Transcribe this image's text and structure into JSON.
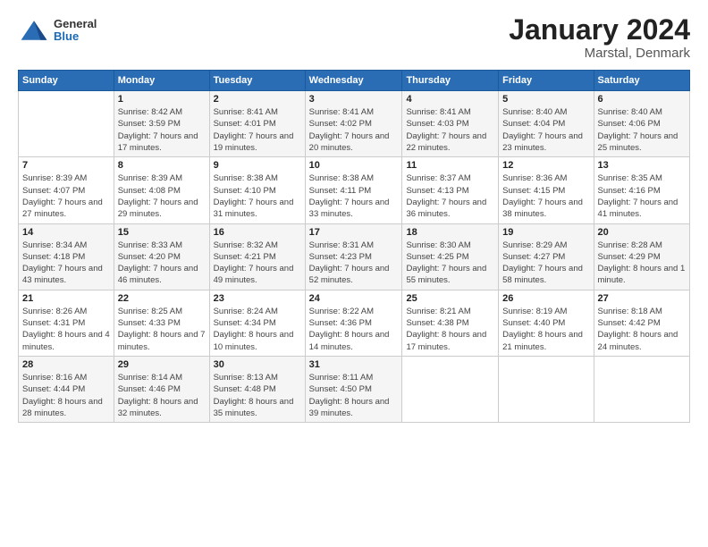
{
  "header": {
    "logo": {
      "general": "General",
      "blue": "Blue"
    },
    "title": "January 2024",
    "location": "Marstal, Denmark"
  },
  "weekdays": [
    "Sunday",
    "Monday",
    "Tuesday",
    "Wednesday",
    "Thursday",
    "Friday",
    "Saturday"
  ],
  "weeks": [
    [
      {
        "day": "",
        "sunrise": "",
        "sunset": "",
        "daylight": ""
      },
      {
        "day": "1",
        "sunrise": "Sunrise: 8:42 AM",
        "sunset": "Sunset: 3:59 PM",
        "daylight": "Daylight: 7 hours and 17 minutes."
      },
      {
        "day": "2",
        "sunrise": "Sunrise: 8:41 AM",
        "sunset": "Sunset: 4:01 PM",
        "daylight": "Daylight: 7 hours and 19 minutes."
      },
      {
        "day": "3",
        "sunrise": "Sunrise: 8:41 AM",
        "sunset": "Sunset: 4:02 PM",
        "daylight": "Daylight: 7 hours and 20 minutes."
      },
      {
        "day": "4",
        "sunrise": "Sunrise: 8:41 AM",
        "sunset": "Sunset: 4:03 PM",
        "daylight": "Daylight: 7 hours and 22 minutes."
      },
      {
        "day": "5",
        "sunrise": "Sunrise: 8:40 AM",
        "sunset": "Sunset: 4:04 PM",
        "daylight": "Daylight: 7 hours and 23 minutes."
      },
      {
        "day": "6",
        "sunrise": "Sunrise: 8:40 AM",
        "sunset": "Sunset: 4:06 PM",
        "daylight": "Daylight: 7 hours and 25 minutes."
      }
    ],
    [
      {
        "day": "7",
        "sunrise": "Sunrise: 8:39 AM",
        "sunset": "Sunset: 4:07 PM",
        "daylight": "Daylight: 7 hours and 27 minutes."
      },
      {
        "day": "8",
        "sunrise": "Sunrise: 8:39 AM",
        "sunset": "Sunset: 4:08 PM",
        "daylight": "Daylight: 7 hours and 29 minutes."
      },
      {
        "day": "9",
        "sunrise": "Sunrise: 8:38 AM",
        "sunset": "Sunset: 4:10 PM",
        "daylight": "Daylight: 7 hours and 31 minutes."
      },
      {
        "day": "10",
        "sunrise": "Sunrise: 8:38 AM",
        "sunset": "Sunset: 4:11 PM",
        "daylight": "Daylight: 7 hours and 33 minutes."
      },
      {
        "day": "11",
        "sunrise": "Sunrise: 8:37 AM",
        "sunset": "Sunset: 4:13 PM",
        "daylight": "Daylight: 7 hours and 36 minutes."
      },
      {
        "day": "12",
        "sunrise": "Sunrise: 8:36 AM",
        "sunset": "Sunset: 4:15 PM",
        "daylight": "Daylight: 7 hours and 38 minutes."
      },
      {
        "day": "13",
        "sunrise": "Sunrise: 8:35 AM",
        "sunset": "Sunset: 4:16 PM",
        "daylight": "Daylight: 7 hours and 41 minutes."
      }
    ],
    [
      {
        "day": "14",
        "sunrise": "Sunrise: 8:34 AM",
        "sunset": "Sunset: 4:18 PM",
        "daylight": "Daylight: 7 hours and 43 minutes."
      },
      {
        "day": "15",
        "sunrise": "Sunrise: 8:33 AM",
        "sunset": "Sunset: 4:20 PM",
        "daylight": "Daylight: 7 hours and 46 minutes."
      },
      {
        "day": "16",
        "sunrise": "Sunrise: 8:32 AM",
        "sunset": "Sunset: 4:21 PM",
        "daylight": "Daylight: 7 hours and 49 minutes."
      },
      {
        "day": "17",
        "sunrise": "Sunrise: 8:31 AM",
        "sunset": "Sunset: 4:23 PM",
        "daylight": "Daylight: 7 hours and 52 minutes."
      },
      {
        "day": "18",
        "sunrise": "Sunrise: 8:30 AM",
        "sunset": "Sunset: 4:25 PM",
        "daylight": "Daylight: 7 hours and 55 minutes."
      },
      {
        "day": "19",
        "sunrise": "Sunrise: 8:29 AM",
        "sunset": "Sunset: 4:27 PM",
        "daylight": "Daylight: 7 hours and 58 minutes."
      },
      {
        "day": "20",
        "sunrise": "Sunrise: 8:28 AM",
        "sunset": "Sunset: 4:29 PM",
        "daylight": "Daylight: 8 hours and 1 minute."
      }
    ],
    [
      {
        "day": "21",
        "sunrise": "Sunrise: 8:26 AM",
        "sunset": "Sunset: 4:31 PM",
        "daylight": "Daylight: 8 hours and 4 minutes."
      },
      {
        "day": "22",
        "sunrise": "Sunrise: 8:25 AM",
        "sunset": "Sunset: 4:33 PM",
        "daylight": "Daylight: 8 hours and 7 minutes."
      },
      {
        "day": "23",
        "sunrise": "Sunrise: 8:24 AM",
        "sunset": "Sunset: 4:34 PM",
        "daylight": "Daylight: 8 hours and 10 minutes."
      },
      {
        "day": "24",
        "sunrise": "Sunrise: 8:22 AM",
        "sunset": "Sunset: 4:36 PM",
        "daylight": "Daylight: 8 hours and 14 minutes."
      },
      {
        "day": "25",
        "sunrise": "Sunrise: 8:21 AM",
        "sunset": "Sunset: 4:38 PM",
        "daylight": "Daylight: 8 hours and 17 minutes."
      },
      {
        "day": "26",
        "sunrise": "Sunrise: 8:19 AM",
        "sunset": "Sunset: 4:40 PM",
        "daylight": "Daylight: 8 hours and 21 minutes."
      },
      {
        "day": "27",
        "sunrise": "Sunrise: 8:18 AM",
        "sunset": "Sunset: 4:42 PM",
        "daylight": "Daylight: 8 hours and 24 minutes."
      }
    ],
    [
      {
        "day": "28",
        "sunrise": "Sunrise: 8:16 AM",
        "sunset": "Sunset: 4:44 PM",
        "daylight": "Daylight: 8 hours and 28 minutes."
      },
      {
        "day": "29",
        "sunrise": "Sunrise: 8:14 AM",
        "sunset": "Sunset: 4:46 PM",
        "daylight": "Daylight: 8 hours and 32 minutes."
      },
      {
        "day": "30",
        "sunrise": "Sunrise: 8:13 AM",
        "sunset": "Sunset: 4:48 PM",
        "daylight": "Daylight: 8 hours and 35 minutes."
      },
      {
        "day": "31",
        "sunrise": "Sunrise: 8:11 AM",
        "sunset": "Sunset: 4:50 PM",
        "daylight": "Daylight: 8 hours and 39 minutes."
      },
      {
        "day": "",
        "sunrise": "",
        "sunset": "",
        "daylight": ""
      },
      {
        "day": "",
        "sunrise": "",
        "sunset": "",
        "daylight": ""
      },
      {
        "day": "",
        "sunrise": "",
        "sunset": "",
        "daylight": ""
      }
    ]
  ]
}
